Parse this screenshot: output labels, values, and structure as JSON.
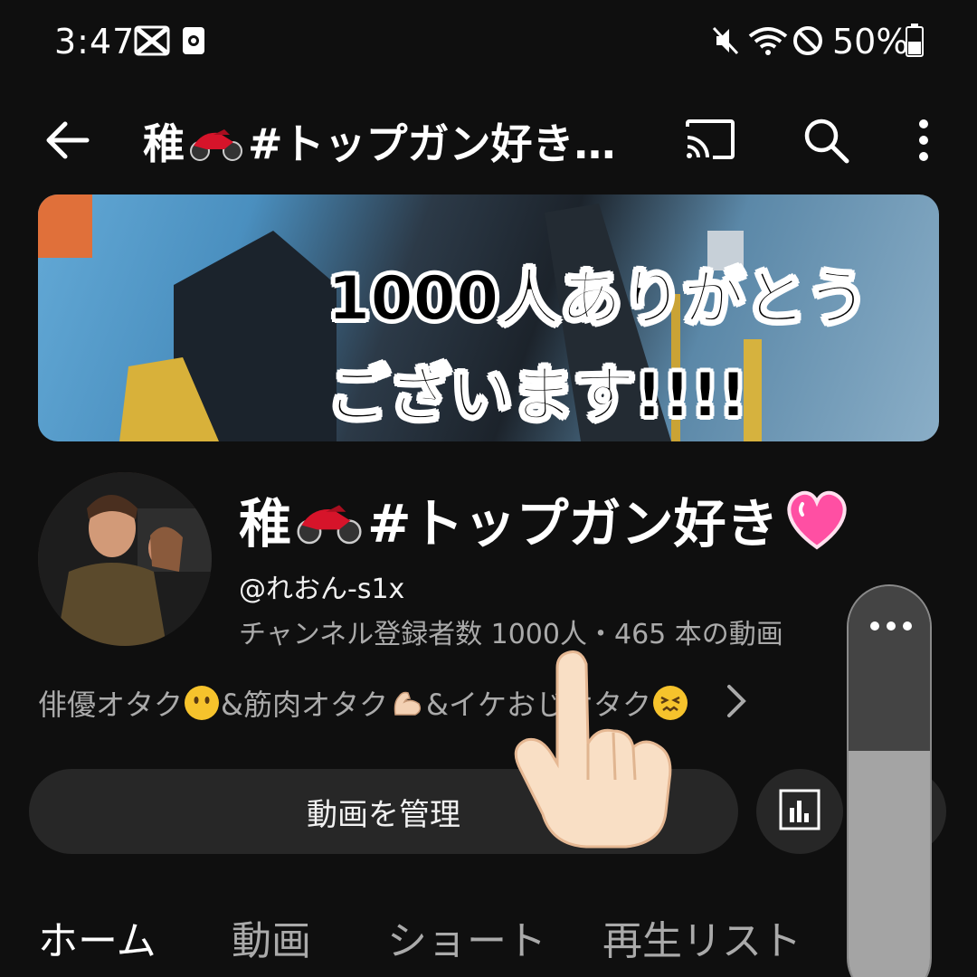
{
  "status_bar": {
    "time": "3:47",
    "battery": "50%",
    "icons": [
      "capcut-icon",
      "screen-record-icon",
      "mute-icon",
      "wifi-icon",
      "do-not-disturb-icon",
      "battery-icon"
    ]
  },
  "app_bar": {
    "title_prefix": "稚",
    "title_suffix": "#トップガン好き…",
    "icons": [
      "back-arrow-icon",
      "cast-icon",
      "search-icon",
      "more-vert-icon"
    ]
  },
  "banner": {
    "line1": "1000人ありがとう",
    "line2": "ございます!!!!"
  },
  "channel": {
    "name_prefix": "稚",
    "name_suffix": "#トップガン好き",
    "handle": "@れおん-s1x",
    "stats": "チャンネル登録者数 1000人・465 本の動画",
    "description_part1": "俳優オタク",
    "description_part2": "&筋肉オタク",
    "description_part3": "&イケおじオタク"
  },
  "actions": {
    "manage_label": "動画を管理"
  },
  "tabs": [
    {
      "label": "ホーム",
      "active": true
    },
    {
      "label": "動画",
      "active": false
    },
    {
      "label": "ショート",
      "active": false
    },
    {
      "label": "再生リスト",
      "active": false
    }
  ],
  "colors": {
    "background": "#0f0f0f",
    "button_bg": "#272727",
    "secondary_text": "#aaaaaa",
    "heart": "#ff4fa3",
    "motorcycle": "#d6142a"
  }
}
